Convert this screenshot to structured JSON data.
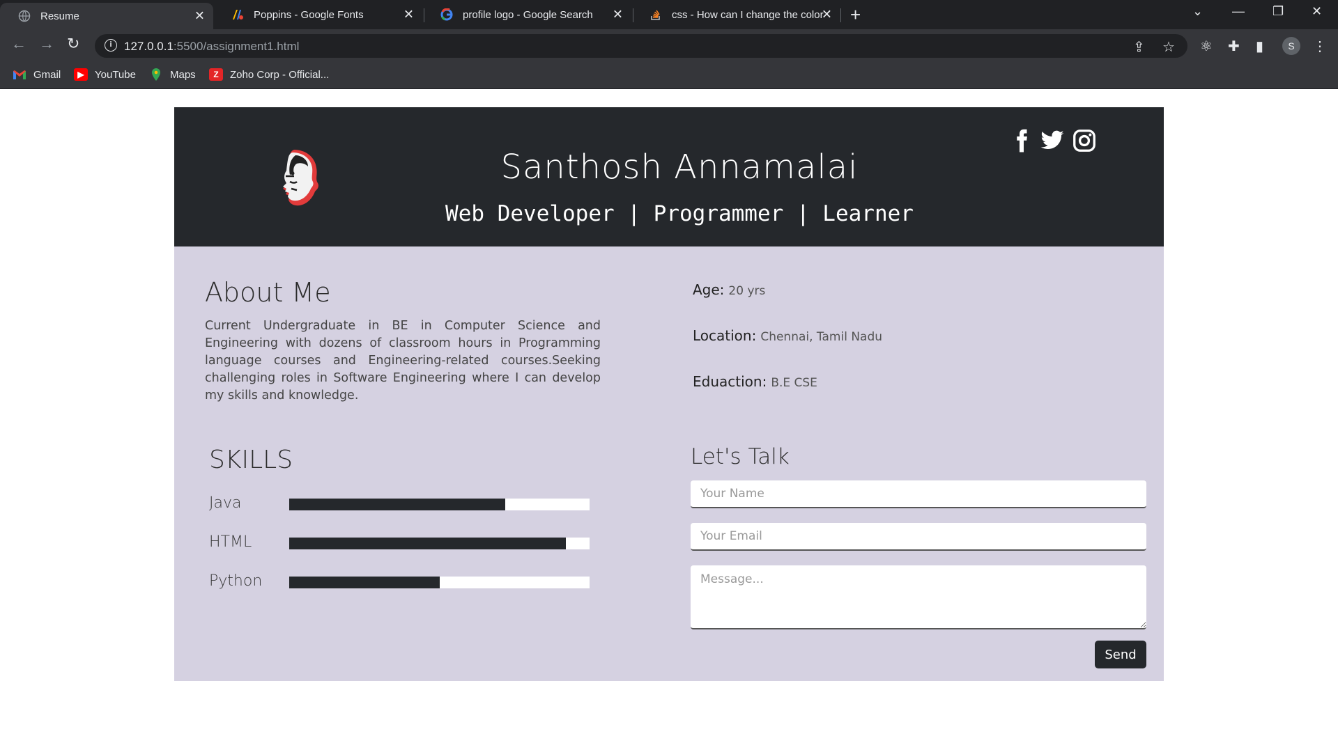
{
  "browser": {
    "tabs": [
      {
        "title": "Resume",
        "icon": "globe-icon",
        "active": true
      },
      {
        "title": "Poppins - Google Fonts",
        "icon": "google-fonts-icon",
        "active": false
      },
      {
        "title": "profile logo - Google Search",
        "icon": "google-icon",
        "active": false
      },
      {
        "title": "css - How can I change the color",
        "icon": "stackoverflow-icon",
        "active": false
      }
    ],
    "url_host": "127.0.0.1",
    "url_path": ":5500/assignment1.html",
    "profile_initial": "S",
    "bookmarks": [
      {
        "label": "Gmail",
        "icon": "gmail-icon"
      },
      {
        "label": "YouTube",
        "icon": "youtube-icon"
      },
      {
        "label": "Maps",
        "icon": "maps-icon"
      },
      {
        "label": "Zoho Corp - Official...",
        "icon": "zoho-icon"
      }
    ]
  },
  "header": {
    "name": "Santhosh Annamalai",
    "roles": "Web Developer | Programmer | Learner",
    "social": [
      "facebook-icon",
      "twitter-icon",
      "instagram-icon"
    ],
    "bg_color": "#25282c"
  },
  "about": {
    "heading": "About Me",
    "text": "Current Undergraduate in BE in Computer Science and Engineering with dozens of classroom hours in Programming language courses and Engineering-related courses.Seeking challenging roles in Software Engineering where I can develop my skills and knowledge."
  },
  "info": [
    {
      "label": "Age:",
      "value": "20 yrs"
    },
    {
      "label": "Location:",
      "value": "Chennai, Tamil Nadu"
    },
    {
      "label": "Eduaction:",
      "value": "B.E CSE"
    }
  ],
  "skills": {
    "heading": "SKILLS",
    "items": [
      {
        "name": "Java",
        "level": 0.72
      },
      {
        "name": "HTML",
        "level": 0.92
      },
      {
        "name": "Python",
        "level": 0.5
      }
    ]
  },
  "contact": {
    "heading": "Let's Talk",
    "name_placeholder": "Your Name",
    "email_placeholder": "Your Email",
    "message_placeholder": "Message...",
    "send_label": "Send"
  },
  "colors": {
    "panel_bg": "#d5d1e1",
    "dark": "#25282c"
  }
}
